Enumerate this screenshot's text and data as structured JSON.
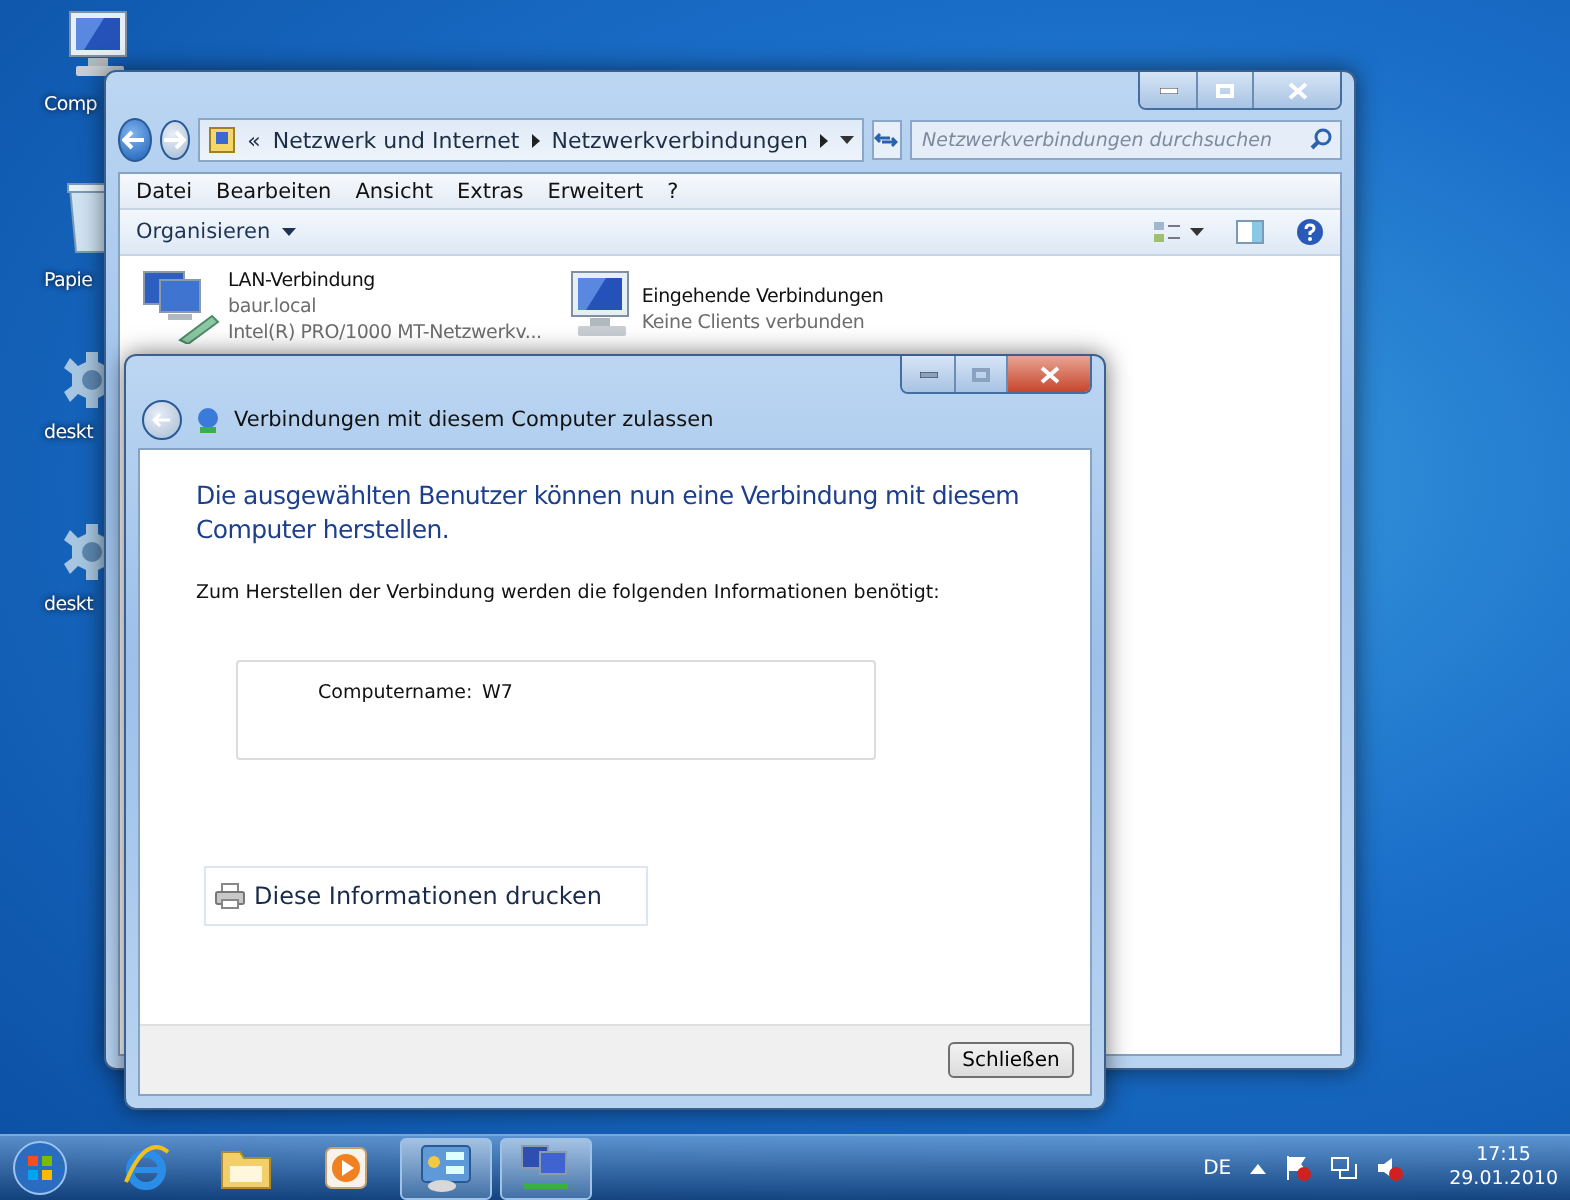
{
  "desktop_icons": [
    {
      "kind": "computer",
      "label": "Comp"
    },
    {
      "kind": "recycle",
      "label": "Papie"
    },
    {
      "kind": "gear",
      "label": "deskt"
    },
    {
      "kind": "gear",
      "label": "deskt"
    }
  ],
  "explorer": {
    "address": {
      "overflow": "«",
      "crumbs": [
        "Netzwerk und Internet",
        "Netzwerkverbindungen"
      ]
    },
    "search": {
      "placeholder": "Netzwerkverbindungen durchsuchen"
    },
    "menu": [
      "Datei",
      "Bearbeiten",
      "Ansicht",
      "Extras",
      "Erweitert",
      "?"
    ],
    "organize": "Organisieren",
    "connections": [
      {
        "kind": "lan",
        "name": "LAN-Verbindung",
        "details": [
          "baur.local",
          "Intel(R) PRO/1000 MT-Netzwerkv..."
        ]
      },
      {
        "kind": "incoming",
        "name": "Eingehende Verbindungen",
        "details": [
          "Keine Clients verbunden"
        ]
      }
    ]
  },
  "dialog": {
    "title": "Verbindungen mit diesem Computer zulassen",
    "heading": "Die ausgewählten Benutzer können nun eine Verbindung mit diesem Computer herstellen.",
    "info": "Zum Herstellen der Verbindung werden die folgenden Informationen benötigt:",
    "fields": [
      {
        "label": "Computername:",
        "value": "W7"
      }
    ],
    "print_link": "Diese Informationen drucken",
    "close_button": "Schließen"
  },
  "taskbar": {
    "items": [
      {
        "kind": "browser",
        "selected": false
      },
      {
        "kind": "folder",
        "selected": false
      },
      {
        "kind": "media",
        "selected": false
      },
      {
        "kind": "control",
        "selected": true
      },
      {
        "kind": "network",
        "selected": true
      }
    ],
    "language": "DE",
    "time": "17:15",
    "date": "29.01.2010"
  }
}
